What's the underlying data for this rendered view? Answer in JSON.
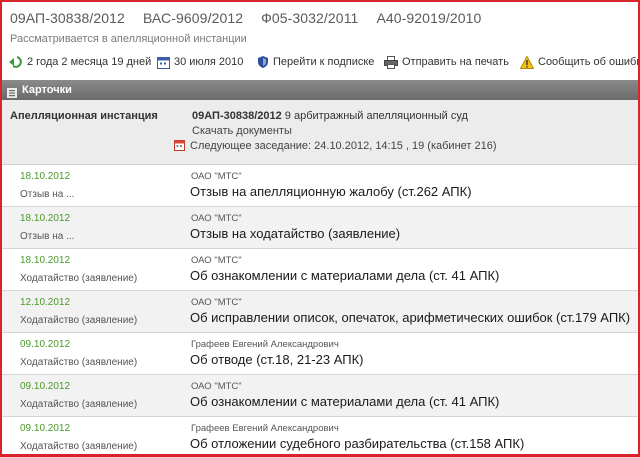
{
  "case_numbers": [
    "09АП-30838/2012",
    "ВАС-9609/2012",
    "Ф05-3032/2011",
    "А40-92019/2010"
  ],
  "status_text": "Рассматривается в апелляционной инстанции",
  "toolbar": {
    "duration": {
      "label": "2 года 2 месяца 19 дней",
      "icon": "back-arrow-icon"
    },
    "date": {
      "label": "30 июля 2010",
      "icon": "calendar-icon"
    },
    "subscribe": {
      "label": "Перейти к подписке",
      "icon": "shield-icon"
    },
    "print": {
      "label": "Отправить на печать",
      "icon": "printer-icon"
    },
    "report_error": {
      "label": "Сообщить об ошибке",
      "icon": "warning-icon"
    }
  },
  "section": {
    "title": "Карточки",
    "icon": "bullet-icon"
  },
  "instance": {
    "label": "Апелляционная инстанция",
    "case_number": "09АП-30838/2012",
    "court": "9 арбитражный апелляционный суд",
    "download_label": "Скачать документы",
    "next_hearing": "Следующее заседание: 24.10.2012, 14:15 , 19 (кабинет 216)"
  },
  "documents": [
    {
      "date": "18.10.2012",
      "type": "Отзыв на ...",
      "org": "ОАО \"МТС\"",
      "title": "Отзыв на апелляционную жалобу (ст.262 АПК)"
    },
    {
      "date": "18.10.2012",
      "type": "Отзыв на ...",
      "org": "ОАО \"МТС\"",
      "title": "Отзыв на ходатайство (заявление)"
    },
    {
      "date": "18.10.2012",
      "type": "Ходатайство (заявление)",
      "org": "ОАО \"МТС\"",
      "title": "Об ознакомлении с материалами дела (ст. 41 АПК)"
    },
    {
      "date": "12.10.2012",
      "type": "Ходатайство (заявление)",
      "org": "ОАО \"МТС\"",
      "title": "Об исправлении описок, опечаток, арифметических ошибок (ст.179 АПК)"
    },
    {
      "date": "09.10.2012",
      "type": "Ходатайство (заявление)",
      "org": "Графеев Евгений Александрович",
      "title": "Об отводе (ст.18, 21-23 АПК)"
    },
    {
      "date": "09.10.2012",
      "type": "Ходатайство (заявление)",
      "org": "ОАО \"МТС\"",
      "title": "Об ознакомлении с материалами дела (ст. 41 АПК)"
    },
    {
      "date": "09.10.2012",
      "type": "Ходатайство (заявление)",
      "org": "Графеев Евгений Александрович",
      "title": "Об отложении судебного разбирательства (ст.158 АПК)"
    }
  ],
  "colors": {
    "frame": "#d6262c",
    "date_green": "#4a9a2a",
    "header_gray": "#7a7a7a",
    "alt_row": "#f2f2f2"
  }
}
